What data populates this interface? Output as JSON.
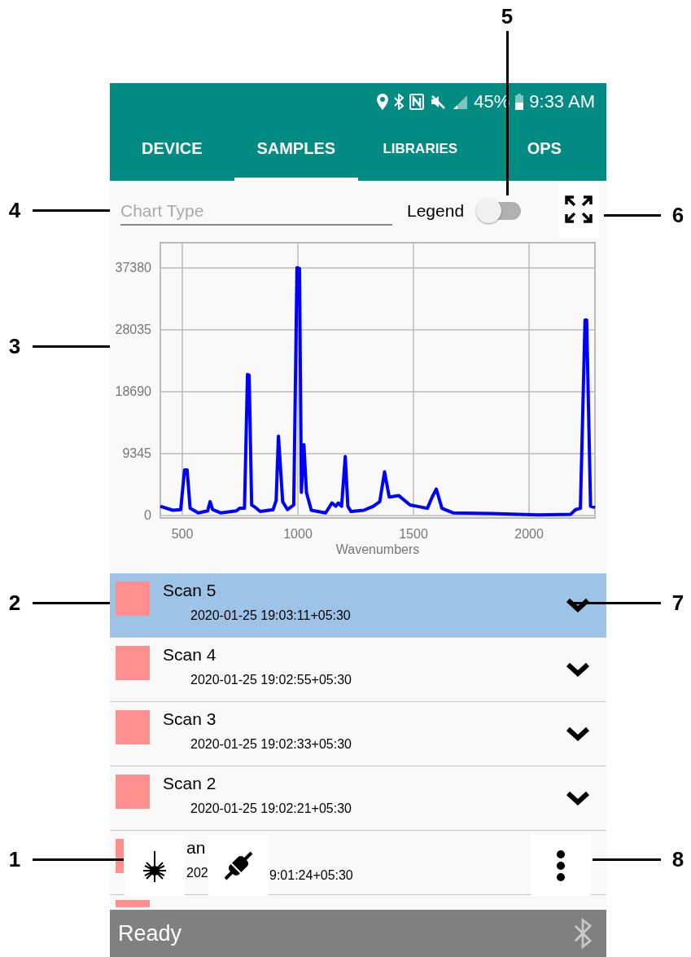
{
  "status_bar": {
    "battery": "45%",
    "time": "9:33 AM"
  },
  "tabs": [
    {
      "label": "DEVICE",
      "selected": false
    },
    {
      "label": "SAMPLES",
      "selected": true
    },
    {
      "label": "LIBRARIES",
      "selected": false
    },
    {
      "label": "OPS",
      "selected": false
    }
  ],
  "toolbar": {
    "chart_type": {
      "placeholder": "Chart Type"
    },
    "legend": {
      "label": "Legend",
      "on": false
    }
  },
  "chart_data": {
    "type": "line",
    "xlabel": "Wavenumbers",
    "grid": true,
    "xlim": [
      405,
      2285
    ],
    "ylim": [
      0,
      41190
    ],
    "xticks": [
      500,
      1000,
      1500,
      2000
    ],
    "yticks": [
      0,
      9345,
      18690,
      28035,
      37380
    ],
    "x": [
      405,
      459,
      493,
      510,
      521,
      534,
      569,
      610,
      620,
      631,
      665,
      734,
      748,
      769,
      782,
      789,
      800,
      817,
      837,
      893,
      906,
      916,
      934,
      955,
      982,
      996,
      1007,
      1015,
      1026,
      1037,
      1058,
      1120,
      1147,
      1164,
      1175,
      1189,
      1205,
      1216,
      1230,
      1285,
      1326,
      1354,
      1375,
      1395,
      1437,
      1485,
      1560,
      1581,
      1599,
      1623,
      1671,
      1836,
      2043,
      2180,
      2201,
      2222,
      2242,
      2249,
      2266,
      2285
    ],
    "series": [
      {
        "color": "#0000ff",
        "values": [
          1400,
          800,
          900,
          6900,
          6900,
          1100,
          400,
          700,
          2100,
          900,
          400,
          700,
          1100,
          1100,
          21300,
          21200,
          1600,
          1200,
          600,
          900,
          2300,
          12000,
          2100,
          900,
          1600,
          37400,
          37300,
          3500,
          10700,
          3500,
          800,
          400,
          1900,
          1400,
          1900,
          1400,
          8900,
          1400,
          600,
          800,
          1400,
          2100,
          6600,
          2800,
          3000,
          1600,
          1100,
          2800,
          4000,
          1100,
          400,
          300,
          100,
          200,
          900,
          1100,
          29500,
          29500,
          1400,
          1200
        ]
      }
    ]
  },
  "scans": [
    {
      "name": "Scan 5",
      "date": "2020-01-25 19:03:11+05:30",
      "color": "#ff8f8f",
      "selected": true
    },
    {
      "name": "Scan 4",
      "date": "2020-01-25 19:02:55+05:30",
      "color": "#ff8f8f",
      "selected": false
    },
    {
      "name": "Scan 3",
      "date": "2020-01-25 19:02:33+05:30",
      "color": "#ff8f8f",
      "selected": false
    },
    {
      "name": "Scan 2",
      "date": "2020-01-25 19:02:21+05:30",
      "color": "#ff8f8f",
      "selected": false
    }
  ],
  "covered_scan": {
    "name": "an",
    "date_start": "202",
    "date_end": "9:01:24+05:30",
    "color": "#ff8f8f"
  },
  "cut_scan": {
    "color": "#ff8f8f"
  },
  "status": {
    "text": "Ready"
  },
  "callouts": [
    {
      "label": "5"
    },
    {
      "label": "4"
    },
    {
      "label": "6"
    },
    {
      "label": "3"
    },
    {
      "label": "2"
    },
    {
      "label": "7"
    },
    {
      "label": "1"
    },
    {
      "label": "8"
    }
  ]
}
